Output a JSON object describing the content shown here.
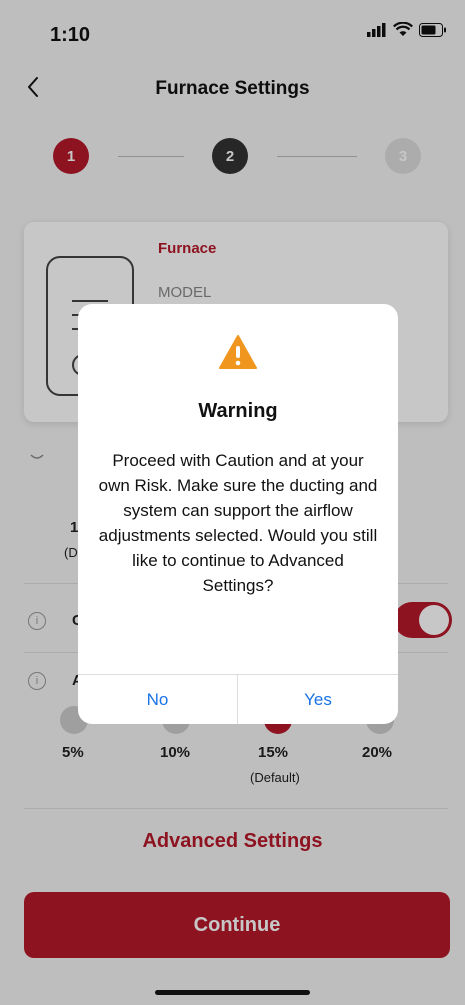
{
  "status": {
    "time": "1:10"
  },
  "nav": {
    "title": "Furnace Settings"
  },
  "stepper": {
    "steps": [
      "1",
      "2",
      "3"
    ]
  },
  "card": {
    "type": "Furnace",
    "model_label": "MODEL"
  },
  "rows": {
    "partial_a": "1",
    "partial_b": "(D",
    "partial_c": "C",
    "partial_d": "A"
  },
  "slider": {
    "labels": [
      "5%",
      "10%",
      "15%",
      "20%"
    ],
    "default_label": "(Default)"
  },
  "advanced_link": "Advanced Settings",
  "continue_label": "Continue",
  "dialog": {
    "title": "Warning",
    "message": "Proceed with Caution and at your own Risk. Make sure the ducting and system can support the airflow adjustments selected. Would you still like to continue to Advanced Settings?",
    "no_label": "No",
    "yes_label": "Yes"
  },
  "colors": {
    "brand_red": "#b7192a",
    "dialog_button_blue": "#1a73e8",
    "warning_orange": "#f0961e"
  }
}
